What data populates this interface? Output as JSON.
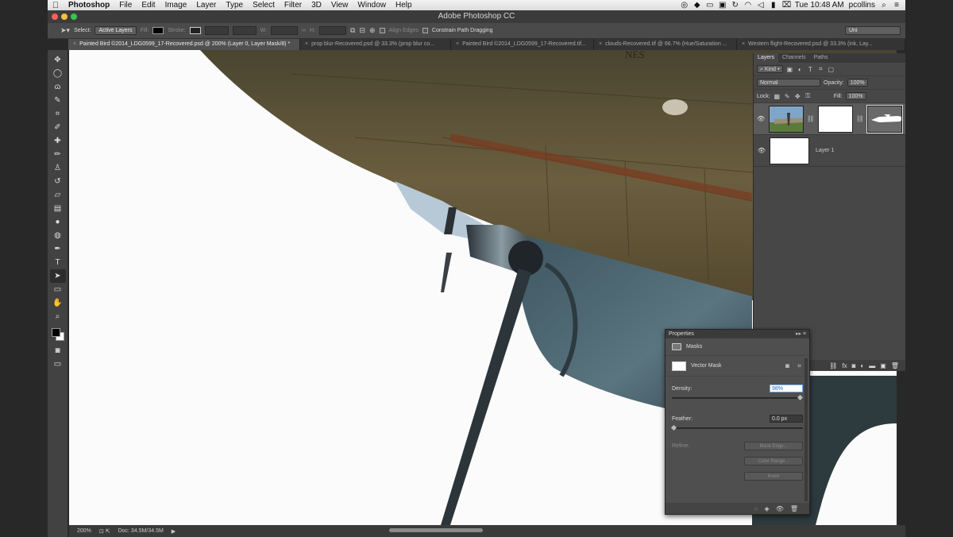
{
  "menubar": {
    "items": [
      "Photoshop",
      "File",
      "Edit",
      "Image",
      "Layer",
      "Type",
      "Select",
      "Filter",
      "3D",
      "View",
      "Window",
      "Help"
    ],
    "clock": "Tue 10:48 AM",
    "user": "pcollins",
    "status_icons": [
      "creative-cloud-icon",
      "dropbox-icon",
      "display-icon",
      "airplay-icon",
      "time-machine-icon",
      "wifi-icon",
      "volume-icon",
      "battery-icon",
      "input-icon"
    ]
  },
  "titlebar": {
    "title": "Adobe Photoshop CC"
  },
  "options": {
    "select_label": "Select:",
    "select_value": "Active Layers",
    "fill_label": "Fill:",
    "stroke_label": "Stroke:",
    "w_label": "W:",
    "h_label": "H:",
    "align_edges": "Align Edges",
    "constrain_path": "Constrain Path Dragging",
    "workspace": "Uni"
  },
  "tabs": [
    {
      "label": "Painted Bird ©2014_LDG0599_17-Recovered.psd @ 200% (Layer 0, Layer Mask/8) *",
      "active": true
    },
    {
      "label": "prop blur-Recovered.psd @ 33.3% (prop blur co...",
      "active": false
    },
    {
      "label": "Painted Bird ©2014_LDG0599_17-Recovered.tif...",
      "active": false
    },
    {
      "label": "clouds-Recovered.tif @ 66.7% (Hue/Saturation ...",
      "active": false
    },
    {
      "label": "Western flight-Recovered.psd @ 33.3% (ink, Lay...",
      "active": false
    }
  ],
  "tools": [
    {
      "icon": "move-tool-icon",
      "glyph": "✥"
    },
    {
      "icon": "elliptical-marquee-icon",
      "glyph": "◯"
    },
    {
      "icon": "lasso-icon",
      "glyph": "ɷ"
    },
    {
      "icon": "quick-select-icon",
      "glyph": "✎"
    },
    {
      "icon": "crop-icon",
      "glyph": "⌗"
    },
    {
      "icon": "eyedropper-icon",
      "glyph": "✐"
    },
    {
      "icon": "healing-brush-icon",
      "glyph": "✚"
    },
    {
      "icon": "brush-icon",
      "glyph": "✏"
    },
    {
      "icon": "clone-stamp-icon",
      "glyph": "♙"
    },
    {
      "icon": "history-brush-icon",
      "glyph": "↺"
    },
    {
      "icon": "eraser-icon",
      "glyph": "▱"
    },
    {
      "icon": "gradient-icon",
      "glyph": "▤"
    },
    {
      "icon": "blur-icon",
      "glyph": "●"
    },
    {
      "icon": "dodge-icon",
      "glyph": "◍"
    },
    {
      "icon": "pen-icon",
      "glyph": "✒"
    },
    {
      "icon": "type-icon",
      "glyph": "T"
    },
    {
      "icon": "path-selection-icon",
      "glyph": "➤"
    },
    {
      "icon": "rectangle-shape-icon",
      "glyph": "▭"
    },
    {
      "icon": "hand-icon",
      "glyph": "✋"
    },
    {
      "icon": "zoom-icon",
      "glyph": "⌕"
    }
  ],
  "status": {
    "zoom": "200%",
    "doc": "Doc: 34.5M/34.5M"
  },
  "layers_panel": {
    "tabs": [
      "Layers",
      "Channels",
      "Paths"
    ],
    "kind": "Kind",
    "blend_mode": "Normal",
    "opacity_label": "Opacity:",
    "opacity": "100%",
    "lock_label": "Lock:",
    "fill_label": "Fill:",
    "fill": "100%",
    "layers": [
      {
        "name": "",
        "selected": true
      },
      {
        "name": "Layer 1",
        "selected": false
      }
    ],
    "footer_icons": [
      "link-layers-icon",
      "fx-icon",
      "add-mask-icon",
      "adjustment-icon",
      "group-icon",
      "new-layer-icon",
      "delete-layer-icon"
    ]
  },
  "properties": {
    "title": "Properties",
    "section": "Masks",
    "mask_type": "Vector Mask",
    "density_label": "Density:",
    "density": "98%",
    "density_fraction": 0.98,
    "feather_label": "Feather:",
    "feather": "0.0 px",
    "refine_label": "Refine:",
    "buttons": [
      "Mask Edge...",
      "Color Range...",
      "Invert"
    ]
  },
  "colors": {
    "accent": "#1a6bd0",
    "panel": "#474747",
    "fuselage": "#5d5238",
    "engine": "#4d6570"
  }
}
